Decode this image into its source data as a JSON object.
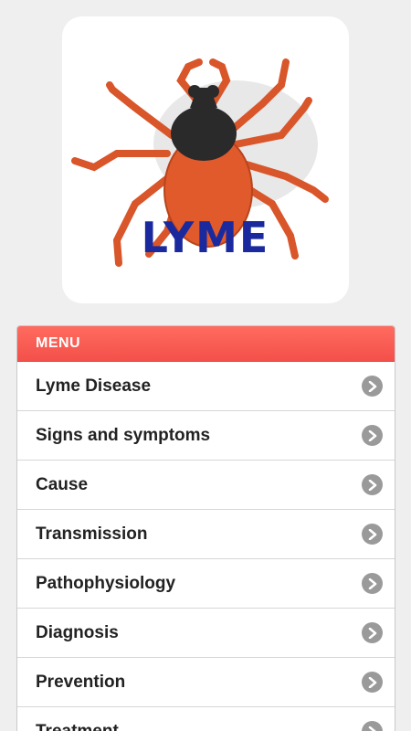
{
  "logo": {
    "text": "LYME",
    "text_color": "#1a2a9e",
    "tick_body_color": "#e05a2b",
    "tick_head_color": "#2a2a2a"
  },
  "menu": {
    "header": "MENU",
    "header_color": "#f55b50",
    "chevron_icon": "chevron-right-icon",
    "items": [
      {
        "label": "Lyme Disease"
      },
      {
        "label": "Signs and symptoms"
      },
      {
        "label": "Cause"
      },
      {
        "label": "Transmission"
      },
      {
        "label": "Pathophysiology"
      },
      {
        "label": "Diagnosis"
      },
      {
        "label": "Prevention"
      },
      {
        "label": "Treatment"
      }
    ]
  }
}
